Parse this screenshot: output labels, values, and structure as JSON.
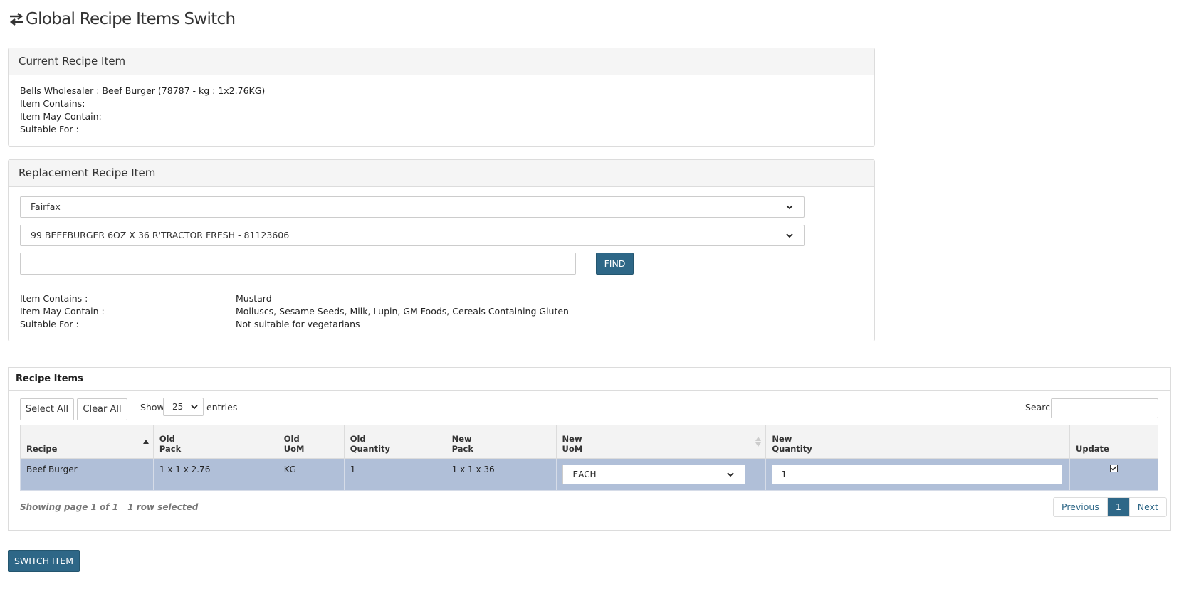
{
  "page": {
    "title": "Global Recipe Items Switch"
  },
  "current": {
    "heading": "Current Recipe Item",
    "item_line": "Bells Wholesaler : Beef Burger (78787 - kg : 1x2.76KG)",
    "contains": "Item Contains:",
    "may_contain": "Item May Contain:",
    "suitable_for": "Suitable For :"
  },
  "replacement": {
    "heading": "Replacement Recipe Item",
    "supplier_value": "Fairfax",
    "product_value": "99 BEEFBURGER 6OZ X 36 R'TRACTOR FRESH - 81123606",
    "search_value": "",
    "find_label": "FIND",
    "contains_label": "Item Contains :",
    "contains_value": "Mustard",
    "may_contain_label": "Item May Contain :",
    "may_contain_value": "Molluscs, Sesame Seeds, Milk, Lupin, GM Foods, Cereals Containing Gluten",
    "suitable_label": "Suitable For :",
    "suitable_value": "Not suitable for vegetarians"
  },
  "recipe_items": {
    "heading": "Recipe Items",
    "select_all": "Select All",
    "clear_all": "Clear All",
    "show_label": "Show",
    "entries_value": "25",
    "entries_label": "entries",
    "search_label": "Search",
    "columns": {
      "recipe": "Recipe",
      "old_pack_1": "Old",
      "old_pack_2": "Pack",
      "old_uom_1": "Old",
      "old_uom_2": "UoM",
      "old_qty_1": "Old",
      "old_qty_2": "Quantity",
      "new_pack_1": "New",
      "new_pack_2": "Pack",
      "new_uom_1": "New",
      "new_uom_2": "UoM",
      "new_qty_1": "New",
      "new_qty_2": "Quantity",
      "update": "Update"
    },
    "rows": [
      {
        "recipe": "Beef Burger",
        "old_pack": "1 x 1 x 2.76",
        "old_uom": "KG",
        "old_quantity": "1",
        "new_pack": "1 x 1 x 36",
        "new_uom": "EACH",
        "new_quantity": "1",
        "update_checked": true
      }
    ],
    "info": "Showing page 1 of 1",
    "selected_info": "1 row selected",
    "pager": {
      "previous": "Previous",
      "page": "1",
      "next": "Next"
    }
  },
  "actions": {
    "switch_item": "SWITCH ITEM"
  },
  "colors": {
    "primary": "#2e6787",
    "selected_row": "#b0bfd8"
  }
}
